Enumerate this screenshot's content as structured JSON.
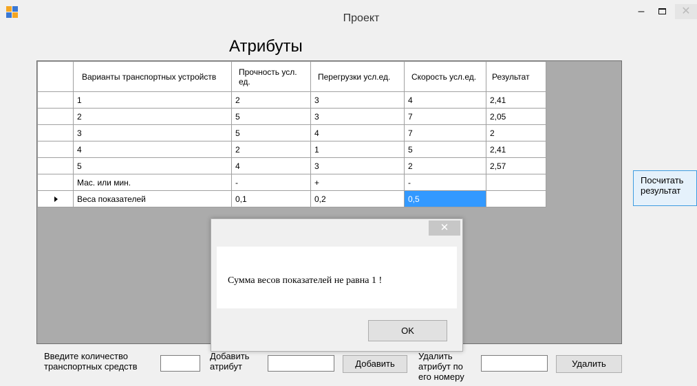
{
  "window": {
    "title": "Проект",
    "min_label": "–",
    "close_label": "✕"
  },
  "heading": "Атрибуты",
  "table": {
    "headers": [
      "Варианты транспортных устройств",
      "Прочность усл. ед.",
      "Перегрузки усл.ед.",
      "Скорость усл.ед.",
      "Результат"
    ],
    "rows": [
      [
        "1",
        "2",
        "3",
        "4",
        "2,41"
      ],
      [
        "2",
        "5",
        "3",
        "7",
        "2,05"
      ],
      [
        "3",
        "5",
        "4",
        "7",
        "2"
      ],
      [
        "4",
        "2",
        "1",
        "5",
        "2,41"
      ],
      [
        "5",
        "4",
        "3",
        "2",
        "2,57"
      ],
      [
        "Мас. или мин.",
        "-",
        "+",
        "-",
        ""
      ],
      [
        "Веса показателей",
        "0,1",
        "0,2",
        "0,5",
        ""
      ]
    ],
    "current_row_index": 6,
    "selected_cell": "0,5"
  },
  "side_button": "Посчитать результат",
  "bottom": {
    "count_label": "Введите количество транспортных средств",
    "count_value": "",
    "add_attr_label": "Добавить атрибут",
    "add_attr_value": "",
    "add_button": "Добавить",
    "delete_label": "Удалить атрибут по его номеру",
    "delete_value": "",
    "delete_button": "Удалить"
  },
  "dialog": {
    "message": "Сумма весов показателей не равна 1 !",
    "ok_label": "OK",
    "close_label": "✕"
  },
  "colors": {
    "selection": "#3399ff",
    "grid_background": "#ababab",
    "hover_button": "#e5f1fb"
  }
}
